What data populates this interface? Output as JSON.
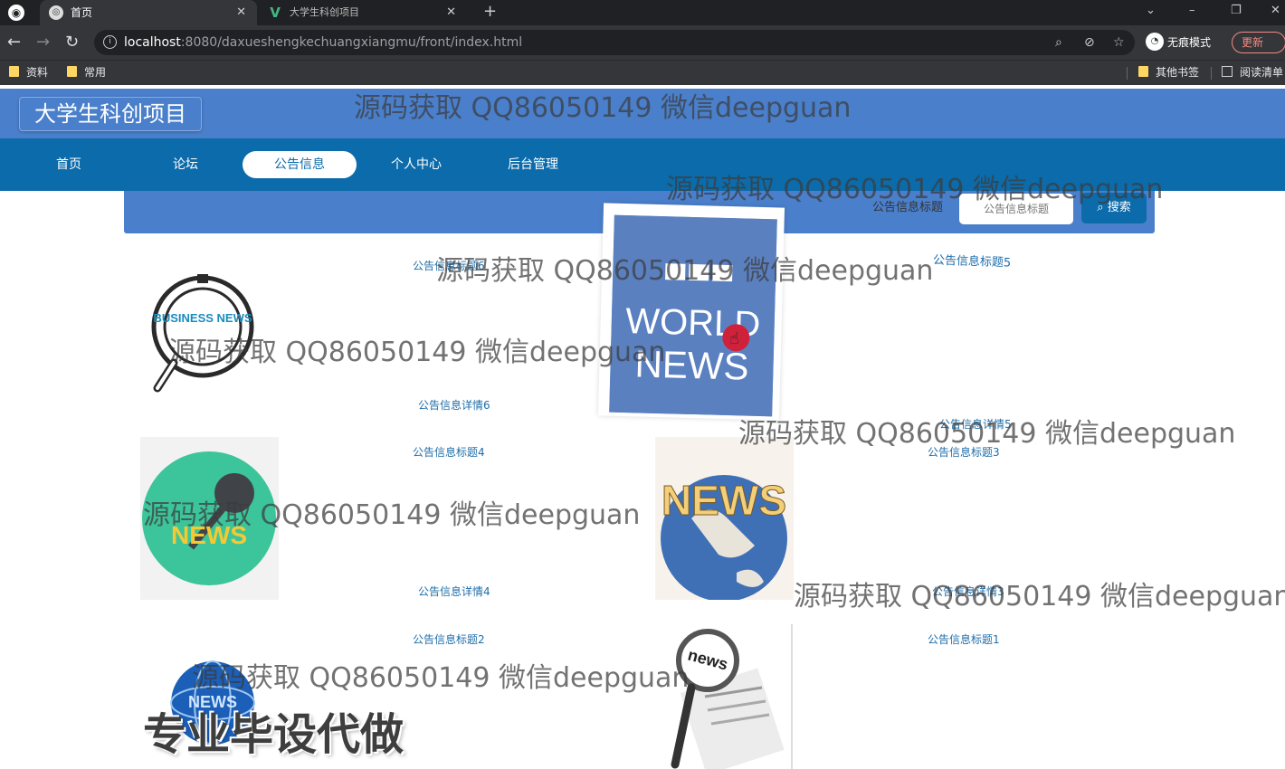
{
  "browser": {
    "tabs": [
      {
        "title": "首页",
        "active": true
      },
      {
        "title": "大学生科创项目",
        "active": false
      }
    ],
    "new_tab": "+",
    "url_host": "localhost",
    "url_path": ":8080/daxueshengkechuangxiangmu/front/index.html",
    "profile_label": "无痕模式",
    "update_label": "更新",
    "bookmarks": [
      "资料",
      "常用"
    ],
    "bookmarks_right": [
      "其他书签",
      "阅读清单"
    ]
  },
  "site": {
    "title": "大学生科创项目",
    "nav": [
      {
        "label": "首页",
        "active": false
      },
      {
        "label": "论坛",
        "active": false
      },
      {
        "label": "公告信息",
        "active": true
      },
      {
        "label": "个人中心",
        "active": false
      },
      {
        "label": "后台管理",
        "active": false
      }
    ]
  },
  "search": {
    "label": "公告信息标题",
    "placeholder": "公告信息标题",
    "button": "搜索"
  },
  "cards": [
    {
      "title": "公告信息标题6",
      "desc": "公告信息详情6",
      "image_label": "BUSINESS NEWS"
    },
    {
      "title": "公告信息标题5",
      "desc": "公告信息详情5",
      "image_label": "BBC WORLD NEWS"
    },
    {
      "title": "公告信息标题4",
      "desc": "公告信息详情4",
      "image_label": "NEWS"
    },
    {
      "title": "公告信息标题3",
      "desc": "公告信息详情3",
      "image_label": "NEWS"
    },
    {
      "title": "公告信息标题2",
      "desc": "",
      "image_label": "NEWS"
    },
    {
      "title": "公告信息标题1",
      "desc": "",
      "image_label": "news"
    }
  ],
  "watermarks": {
    "text": "源码获取 QQ86050149 微信deepguan",
    "bold_text": "专业毕设代做"
  },
  "colors": {
    "header": "#4a7fcb",
    "nav": "#0c6baa",
    "link": "#1f6ea8"
  }
}
